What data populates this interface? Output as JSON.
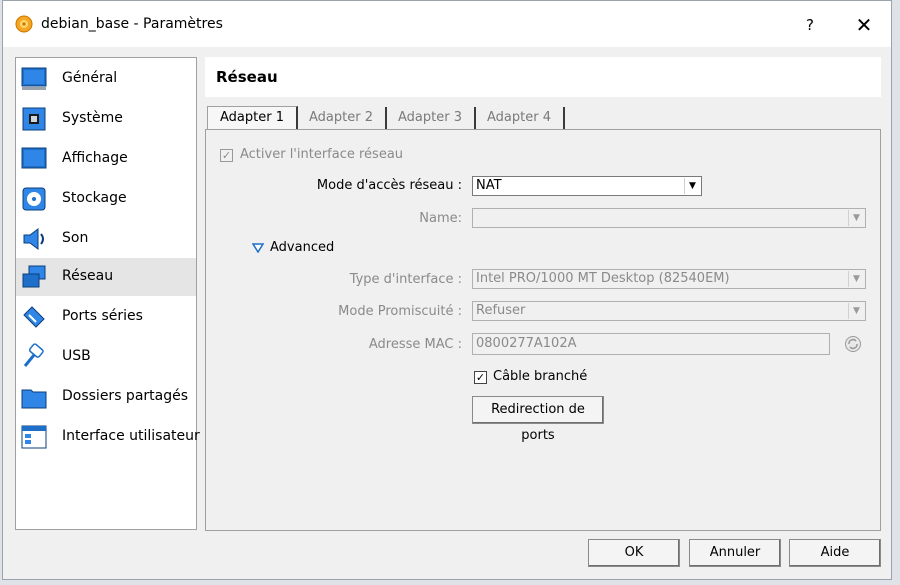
{
  "window": {
    "title": "debian_base - Paramètres",
    "help_label": "?",
    "close_label": "✕"
  },
  "sidebar": {
    "items": [
      {
        "label": "Général",
        "icon": "general-icon"
      },
      {
        "label": "Système",
        "icon": "system-icon"
      },
      {
        "label": "Affichage",
        "icon": "display-icon"
      },
      {
        "label": "Stockage",
        "icon": "storage-icon"
      },
      {
        "label": "Son",
        "icon": "sound-icon"
      },
      {
        "label": "Réseau",
        "icon": "network-icon",
        "selected": true
      },
      {
        "label": "Ports séries",
        "icon": "serial-ports-icon"
      },
      {
        "label": "USB",
        "icon": "usb-icon"
      },
      {
        "label": "Dossiers partagés",
        "icon": "shared-folders-icon"
      },
      {
        "label": "Interface utilisateur",
        "icon": "user-interface-icon"
      }
    ]
  },
  "content": {
    "title": "Réseau",
    "tabs": [
      {
        "label": "Adapter 1",
        "active": true
      },
      {
        "label": "Adapter 2"
      },
      {
        "label": "Adapter 3"
      },
      {
        "label": "Adapter 4"
      }
    ],
    "enable_adapter": {
      "label": "Activer l'interface réseau",
      "checked": true
    },
    "attached_to": {
      "label": "Mode d'accès réseau :",
      "value": "NAT"
    },
    "name": {
      "label": "Name:",
      "value": ""
    },
    "advanced_label": "Advanced",
    "adapter_type": {
      "label": "Type d'interface :",
      "value": "Intel PRO/1000 MT Desktop (82540EM)"
    },
    "promiscuous": {
      "label": "Mode Promiscuité :",
      "value": "Refuser"
    },
    "mac": {
      "label": "Adresse MAC :",
      "value": "0800277A102A"
    },
    "cable": {
      "label": "Câble branché",
      "checked": true
    },
    "port_forwarding_label": "Redirection de ports"
  },
  "footer": {
    "ok": "OK",
    "cancel": "Annuler",
    "help": "Aide"
  },
  "colors": {
    "accent_blue": "#1e6fc9",
    "selected_bg": "#e5e5e5"
  }
}
